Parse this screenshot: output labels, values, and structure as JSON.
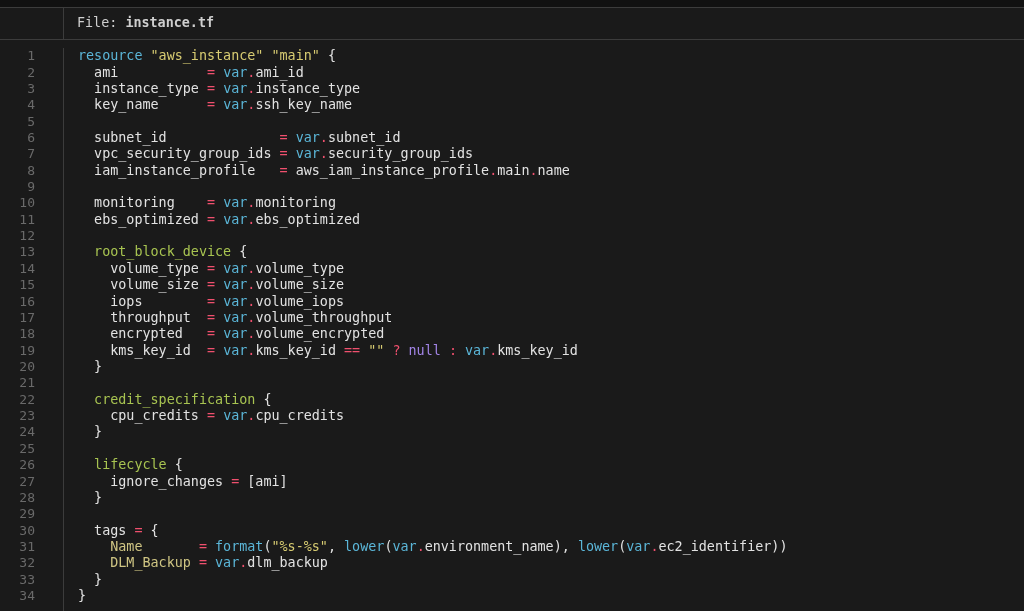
{
  "file_label": "File: **instance.tf**",
  "lines": [
    {
      "number": "1",
      "tokens": [
        {
          "kind": "keyword",
          "text": "resource "
        },
        {
          "kind": "string",
          "text": "\"aws_instance\" "
        },
        {
          "kind": "string",
          "text": "\"main\""
        },
        {
          "kind": "plain",
          "text": " {"
        }
      ]
    },
    {
      "number": "2",
      "tokens": [
        {
          "kind": "plain",
          "text": "  ami           "
        },
        {
          "kind": "operator",
          "text": "= "
        },
        {
          "kind": "keyword",
          "text": "var"
        },
        {
          "kind": "operator",
          "text": "."
        },
        {
          "kind": "plain",
          "text": "ami_id"
        }
      ]
    },
    {
      "number": "3",
      "tokens": [
        {
          "kind": "plain",
          "text": "  instance_type "
        },
        {
          "kind": "operator",
          "text": "= "
        },
        {
          "kind": "keyword",
          "text": "var"
        },
        {
          "kind": "operator",
          "text": "."
        },
        {
          "kind": "plain",
          "text": "instance_type"
        }
      ]
    },
    {
      "number": "4",
      "tokens": [
        {
          "kind": "plain",
          "text": "  key_name      "
        },
        {
          "kind": "operator",
          "text": "= "
        },
        {
          "kind": "keyword",
          "text": "var"
        },
        {
          "kind": "operator",
          "text": "."
        },
        {
          "kind": "plain",
          "text": "ssh_key_name"
        }
      ]
    },
    {
      "number": "5"
    },
    {
      "number": "6",
      "tokens": [
        {
          "kind": "plain",
          "text": "  subnet_id              "
        },
        {
          "kind": "operator",
          "text": "= "
        },
        {
          "kind": "keyword",
          "text": "var"
        },
        {
          "kind": "operator",
          "text": "."
        },
        {
          "kind": "plain",
          "text": "subnet_id"
        }
      ]
    },
    {
      "number": "7",
      "tokens": [
        {
          "kind": "plain",
          "text": "  vpc_security_group_ids "
        },
        {
          "kind": "operator",
          "text": "= "
        },
        {
          "kind": "keyword",
          "text": "var"
        },
        {
          "kind": "operator",
          "text": "."
        },
        {
          "kind": "plain",
          "text": "security_group_ids"
        }
      ]
    },
    {
      "number": "8",
      "tokens": [
        {
          "kind": "plain",
          "text": "  iam_instance_profile   "
        },
        {
          "kind": "operator",
          "text": "="
        },
        {
          "kind": "plain",
          "text": " aws_iam_instance_profile"
        },
        {
          "kind": "operator",
          "text": "."
        },
        {
          "kind": "plain",
          "text": "main"
        },
        {
          "kind": "operator",
          "text": "."
        },
        {
          "kind": "plain",
          "text": "name"
        }
      ]
    },
    {
      "number": "9"
    },
    {
      "number": "10",
      "tokens": [
        {
          "kind": "plain",
          "text": "  monitoring    "
        },
        {
          "kind": "operator",
          "text": "= "
        },
        {
          "kind": "keyword",
          "text": "var"
        },
        {
          "kind": "operator",
          "text": "."
        },
        {
          "kind": "plain",
          "text": "monitoring"
        }
      ]
    },
    {
      "number": "11",
      "tokens": [
        {
          "kind": "plain",
          "text": "  ebs_optimized "
        },
        {
          "kind": "operator",
          "text": "= "
        },
        {
          "kind": "keyword",
          "text": "var"
        },
        {
          "kind": "operator",
          "text": "."
        },
        {
          "kind": "plain",
          "text": "ebs_optimized"
        }
      ]
    },
    {
      "number": "12"
    },
    {
      "number": "13",
      "tokens": [
        {
          "kind": "block",
          "text": "  root_block_device"
        },
        {
          "kind": "plain",
          "text": " {"
        }
      ]
    },
    {
      "number": "14",
      "tokens": [
        {
          "kind": "plain",
          "text": "    volume_type "
        },
        {
          "kind": "operator",
          "text": "= "
        },
        {
          "kind": "keyword",
          "text": "var"
        },
        {
          "kind": "operator",
          "text": "."
        },
        {
          "kind": "plain",
          "text": "volume_type"
        }
      ]
    },
    {
      "number": "15",
      "tokens": [
        {
          "kind": "plain",
          "text": "    volume_size "
        },
        {
          "kind": "operator",
          "text": "= "
        },
        {
          "kind": "keyword",
          "text": "var"
        },
        {
          "kind": "operator",
          "text": "."
        },
        {
          "kind": "plain",
          "text": "volume_size"
        }
      ]
    },
    {
      "number": "16",
      "tokens": [
        {
          "kind": "plain",
          "text": "    iops        "
        },
        {
          "kind": "operator",
          "text": "= "
        },
        {
          "kind": "keyword",
          "text": "var"
        },
        {
          "kind": "operator",
          "text": "."
        },
        {
          "kind": "plain",
          "text": "volume_iops"
        }
      ]
    },
    {
      "number": "17",
      "tokens": [
        {
          "kind": "plain",
          "text": "    throughput  "
        },
        {
          "kind": "operator",
          "text": "= "
        },
        {
          "kind": "keyword",
          "text": "var"
        },
        {
          "kind": "operator",
          "text": "."
        },
        {
          "kind": "plain",
          "text": "volume_throughput"
        }
      ]
    },
    {
      "number": "18",
      "tokens": [
        {
          "kind": "plain",
          "text": "    encrypted   "
        },
        {
          "kind": "operator",
          "text": "= "
        },
        {
          "kind": "keyword",
          "text": "var"
        },
        {
          "kind": "operator",
          "text": "."
        },
        {
          "kind": "plain",
          "text": "volume_encrypted"
        }
      ]
    },
    {
      "number": "19",
      "tokens": [
        {
          "kind": "plain",
          "text": "    kms_key_id  "
        },
        {
          "kind": "operator",
          "text": "= "
        },
        {
          "kind": "keyword",
          "text": "var"
        },
        {
          "kind": "operator",
          "text": "."
        },
        {
          "kind": "plain",
          "text": "kms_key_id "
        },
        {
          "kind": "operator",
          "text": "== "
        },
        {
          "kind": "string",
          "text": "\"\" "
        },
        {
          "kind": "operator",
          "text": "? "
        },
        {
          "kind": "null",
          "text": "null "
        },
        {
          "kind": "operator",
          "text": ": "
        },
        {
          "kind": "keyword",
          "text": "var"
        },
        {
          "kind": "operator",
          "text": "."
        },
        {
          "kind": "plain",
          "text": "kms_key_id"
        }
      ]
    },
    {
      "number": "20",
      "tokens": [
        {
          "kind": "plain",
          "text": "  }"
        }
      ]
    },
    {
      "number": "21"
    },
    {
      "number": "22",
      "tokens": [
        {
          "kind": "block",
          "text": "  credit_specification"
        },
        {
          "kind": "plain",
          "text": " {"
        }
      ]
    },
    {
      "number": "23",
      "tokens": [
        {
          "kind": "plain",
          "text": "    cpu_credits "
        },
        {
          "kind": "operator",
          "text": "= "
        },
        {
          "kind": "keyword",
          "text": "var"
        },
        {
          "kind": "operator",
          "text": "."
        },
        {
          "kind": "plain",
          "text": "cpu_credits"
        }
      ]
    },
    {
      "number": "24",
      "tokens": [
        {
          "kind": "plain",
          "text": "  }"
        }
      ]
    },
    {
      "number": "25"
    },
    {
      "number": "26",
      "tokens": [
        {
          "kind": "block",
          "text": "  lifecycle"
        },
        {
          "kind": "plain",
          "text": " {"
        }
      ]
    },
    {
      "number": "27",
      "tokens": [
        {
          "kind": "plain",
          "text": "    ignore_changes "
        },
        {
          "kind": "operator",
          "text": "="
        },
        {
          "kind": "plain",
          "text": " [ami]"
        }
      ]
    },
    {
      "number": "28",
      "tokens": [
        {
          "kind": "plain",
          "text": "  }"
        }
      ]
    },
    {
      "number": "29"
    },
    {
      "number": "30",
      "tokens": [
        {
          "kind": "plain",
          "text": "  tags "
        },
        {
          "kind": "operator",
          "text": "="
        },
        {
          "kind": "plain",
          "text": " {"
        }
      ]
    },
    {
      "number": "31",
      "tokens": [
        {
          "kind": "attribute",
          "text": "    Name       "
        },
        {
          "kind": "operator",
          "text": "= "
        },
        {
          "kind": "keyword",
          "text": "format"
        },
        {
          "kind": "plain",
          "text": "("
        },
        {
          "kind": "string",
          "text": "\"%s-%s\""
        },
        {
          "kind": "plain",
          "text": ", "
        },
        {
          "kind": "keyword",
          "text": "lower"
        },
        {
          "kind": "plain",
          "text": "("
        },
        {
          "kind": "keyword",
          "text": "var"
        },
        {
          "kind": "operator",
          "text": "."
        },
        {
          "kind": "plain",
          "text": "environment_name), "
        },
        {
          "kind": "keyword",
          "text": "lower"
        },
        {
          "kind": "plain",
          "text": "("
        },
        {
          "kind": "keyword",
          "text": "var"
        },
        {
          "kind": "operator",
          "text": "."
        },
        {
          "kind": "plain",
          "text": "ec2_identifier))"
        }
      ]
    },
    {
      "number": "32",
      "tokens": [
        {
          "kind": "attribute",
          "text": "    DLM_Backup "
        },
        {
          "kind": "operator",
          "text": "= "
        },
        {
          "kind": "keyword",
          "text": "var"
        },
        {
          "kind": "operator",
          "text": "."
        },
        {
          "kind": "plain",
          "text": "dlm_backup"
        }
      ]
    },
    {
      "number": "33",
      "tokens": [
        {
          "kind": "plain",
          "text": "  }"
        }
      ]
    },
    {
      "number": "34",
      "tokens": [
        {
          "kind": "plain",
          "text": "}"
        }
      ]
    }
  ]
}
